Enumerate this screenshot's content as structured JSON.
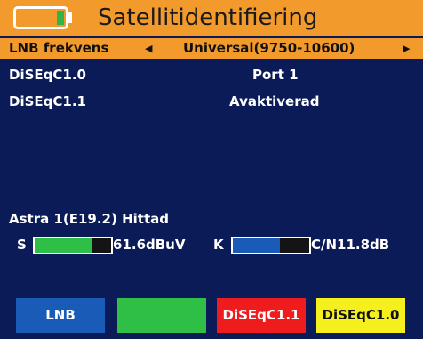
{
  "header": {
    "title": "Satellitidentifiering",
    "battery_level": 0.15
  },
  "lnb": {
    "label": "LNB frekvens",
    "left_arrow": "◀",
    "value": "Universal(9750-10600)",
    "right_arrow": "▶"
  },
  "diseqc": [
    {
      "label": "DiSEqC1.0",
      "value": "Port 1"
    },
    {
      "label": "DiSEqC1.1",
      "value": "Avaktiverad"
    }
  ],
  "status": {
    "satellite": "Astra 1(E19.2) Hittad",
    "signal_label": "S",
    "signal_value": "61.6dBuV",
    "signal_level": 0.75,
    "quality_label": "K",
    "quality_value": "C/N11.8dB",
    "quality_level": 0.62
  },
  "buttons": [
    {
      "label": "LNB",
      "color": "#1a5bb8"
    },
    {
      "label": "",
      "color": "#2fbf46"
    },
    {
      "label": "DiSEqC1.1",
      "color": "#ee1c1c"
    },
    {
      "label": "DiSEqC1.0",
      "color": "#f5ef1e"
    }
  ],
  "colors": {
    "background": "#0b1b58",
    "header": "#f39a2c",
    "signal_bar": "#2fbf46",
    "quality_bar": "#1a5bb8"
  }
}
